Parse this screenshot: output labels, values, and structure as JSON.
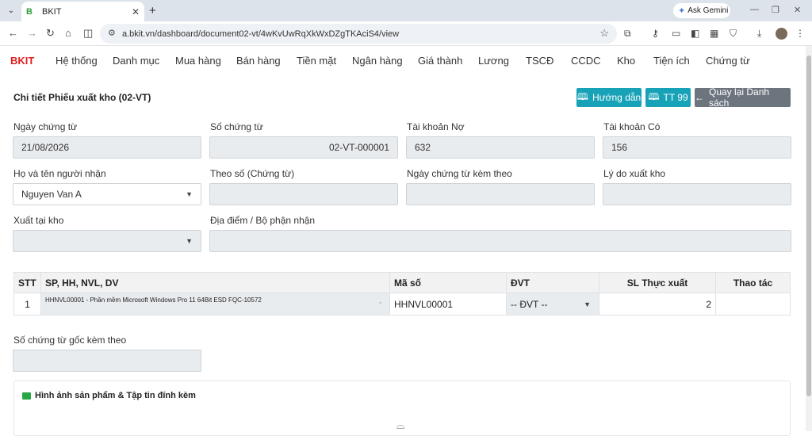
{
  "browser": {
    "tab_title": "BKIT",
    "tab_favicon": "B",
    "url": "a.bkit.vn/dashboard/document02-vt/4wKvUwRqXkWxDZgTKAciS4/view",
    "gemini_label": "Ask Gemini"
  },
  "nav": {
    "brand": "BKIT",
    "items": [
      "Hệ thống",
      "Danh mục",
      "Mua hàng",
      "Bán hàng",
      "Tiền mặt",
      "Ngân hàng",
      "Giá thành",
      "Lương",
      "TSCĐ",
      "CCDC",
      "Kho",
      "Tiện ích",
      "Chứng từ"
    ]
  },
  "page": {
    "title": "Chi tiết Phiếu xuất kho (02-VT)",
    "btn_guide": "Hướng dẫn",
    "btn_tt99": "TT 99",
    "btn_back": "Quay lại Danh sách"
  },
  "form": {
    "ngay_chung_tu": {
      "label": "Ngày chứng từ",
      "value": "21/08/2026"
    },
    "so_chung_tu": {
      "label": "Số chứng từ",
      "value": "02-VT-000001"
    },
    "tk_no": {
      "label": "Tài khoản Nợ",
      "value": "632"
    },
    "tk_co": {
      "label": "Tài khoản Có",
      "value": "156"
    },
    "nguoi_nhan": {
      "label": "Họ và tên người nhận",
      "value": "Nguyen Van A"
    },
    "theo_so": {
      "label": "Theo số (Chứng từ)",
      "value": ""
    },
    "ngay_kem_theo": {
      "label": "Ngày chứng từ kèm theo",
      "value": ""
    },
    "ly_do": {
      "label": "Lý do xuất kho",
      "value": ""
    },
    "xuat_tai_kho": {
      "label": "Xuất tại kho",
      "value": ""
    },
    "dia_diem": {
      "label": "Địa điểm / Bộ phận nhận",
      "value": ""
    }
  },
  "table": {
    "headers": {
      "stt": "STT",
      "sp": "SP, HH, NVL, DV",
      "ma_so": "Mã số",
      "dvt": "ĐVT",
      "sl": "SL Thực xuất",
      "thao_tac": "Thao tác"
    },
    "rows": [
      {
        "stt": "1",
        "sp": "HHNVL00001 - Phần mềm Microsoft Windows Pro 11 64Bit ESD FQC-10572",
        "ma_so": "HHNVL00001",
        "dvt": "-- ĐVT --",
        "sl": "2",
        "thao_tac": ""
      }
    ]
  },
  "so_chung_tu_goc": {
    "label": "Số chứng từ gốc kèm theo",
    "value": ""
  },
  "attachments": {
    "title": "Hình ảnh sản phẩm & Tập tin đính kèm"
  }
}
